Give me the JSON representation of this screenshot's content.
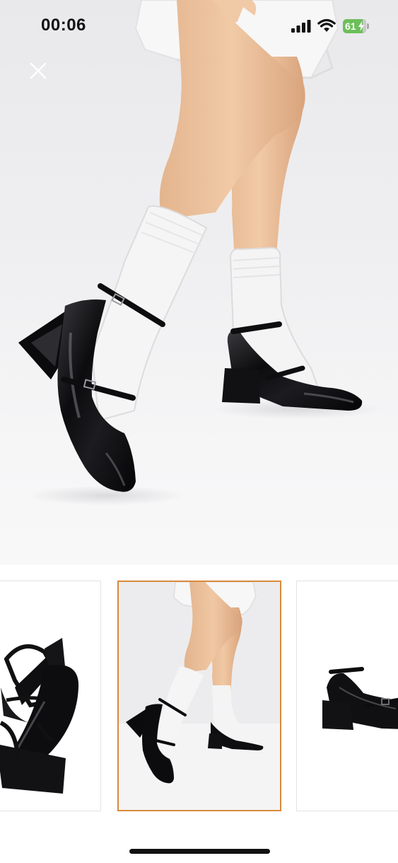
{
  "status_bar": {
    "time": "00:06",
    "battery_level": "61",
    "battery_fraction": 0.61,
    "battery_charging": true,
    "battery_color": "#6cbf5a"
  },
  "viewer": {
    "close_icon": "close-icon",
    "hero_image": "model-wearing-black-patent-mary-jane-heels-with-white-socks"
  },
  "thumbnails": [
    {
      "image": "black-patent-mary-jane-pair-side-view",
      "selected": false
    },
    {
      "image": "model-wearing-black-patent-mary-jane-heels-with-white-socks",
      "selected": true
    },
    {
      "image": "black-patent-mary-jane-single-shoe-side-view",
      "selected": false
    }
  ],
  "accent_color": "#d88a3d"
}
